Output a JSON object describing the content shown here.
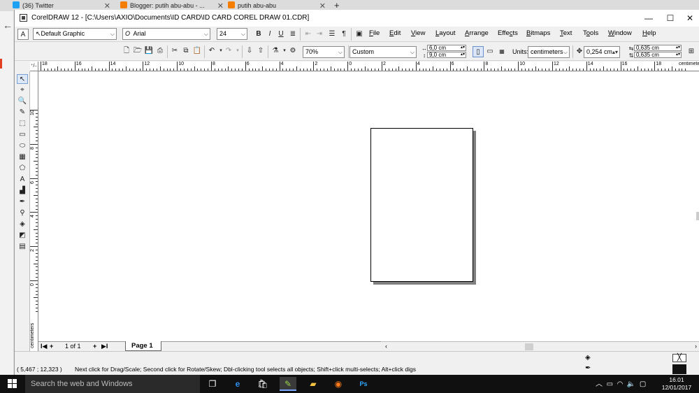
{
  "browser": {
    "tabs": [
      {
        "label": "(36) Twitter",
        "color": "#1da1f2"
      },
      {
        "label": "Blogger: putih abu-abu - ...",
        "color": "#f57d00"
      },
      {
        "label": "putih abu-abu",
        "color": "#f57d00"
      }
    ],
    "new_tab": "+"
  },
  "window": {
    "title": "CorelDRAW 12 - [C:\\Users\\AXIO\\Documents\\ID CARD\\ID CARD COREL DRAW 01.CDR]",
    "minimize": "—",
    "maximize": "☐",
    "close": "✕"
  },
  "toolbar1": {
    "graphic_style": "Default Graphic",
    "font_name": "Arial",
    "font_size": "24",
    "font_icon": "O"
  },
  "menu": {
    "items": [
      "File",
      "Edit",
      "View",
      "Layout",
      "Arrange",
      "Effects",
      "Bitmaps",
      "Text",
      "Tools",
      "Window",
      "Help"
    ],
    "underline": [
      "F",
      "E",
      "V",
      "L",
      "A",
      "c",
      "B",
      "T",
      "o",
      "W",
      "H"
    ]
  },
  "toolbar2": {
    "zoom": "70%",
    "paper": "Custom",
    "width": "6,0 cm",
    "height": "9,0 cm",
    "units_label": "Units:",
    "units": "centimeters",
    "nudge": "0,254 cm",
    "dup_x": "0,635 cm",
    "dup_y": "0,635 cm"
  },
  "ruler": {
    "corner": "⁺/₋",
    "h_labels": [
      "18",
      "16",
      "14",
      "12",
      "10",
      "8",
      "6",
      "4",
      "2",
      "0",
      "2",
      "4",
      "6",
      "8",
      "10",
      "12",
      "14",
      "16",
      "18"
    ],
    "h_unit": "centimeters",
    "v_labels": [
      "10",
      "8",
      "6",
      "4",
      "2",
      "0"
    ],
    "v_unit": "centimeters"
  },
  "pagenav": {
    "first": "I◀",
    "add_before": "+",
    "counter": "1 of 1",
    "add_after": "+",
    "last": "▶I",
    "page_tab": "Page 1"
  },
  "status": {
    "coords": "( 5,467 ; 12,323 )",
    "hint": "Next click for Drag/Scale; Second click for Rotate/Skew; Dbl-clicking tool selects all objects; Shift+click multi-selects; Alt+click digs"
  },
  "taskbar": {
    "search_placeholder": "Search the web and Windows",
    "time": "16.01",
    "date": "12/01/2017"
  }
}
